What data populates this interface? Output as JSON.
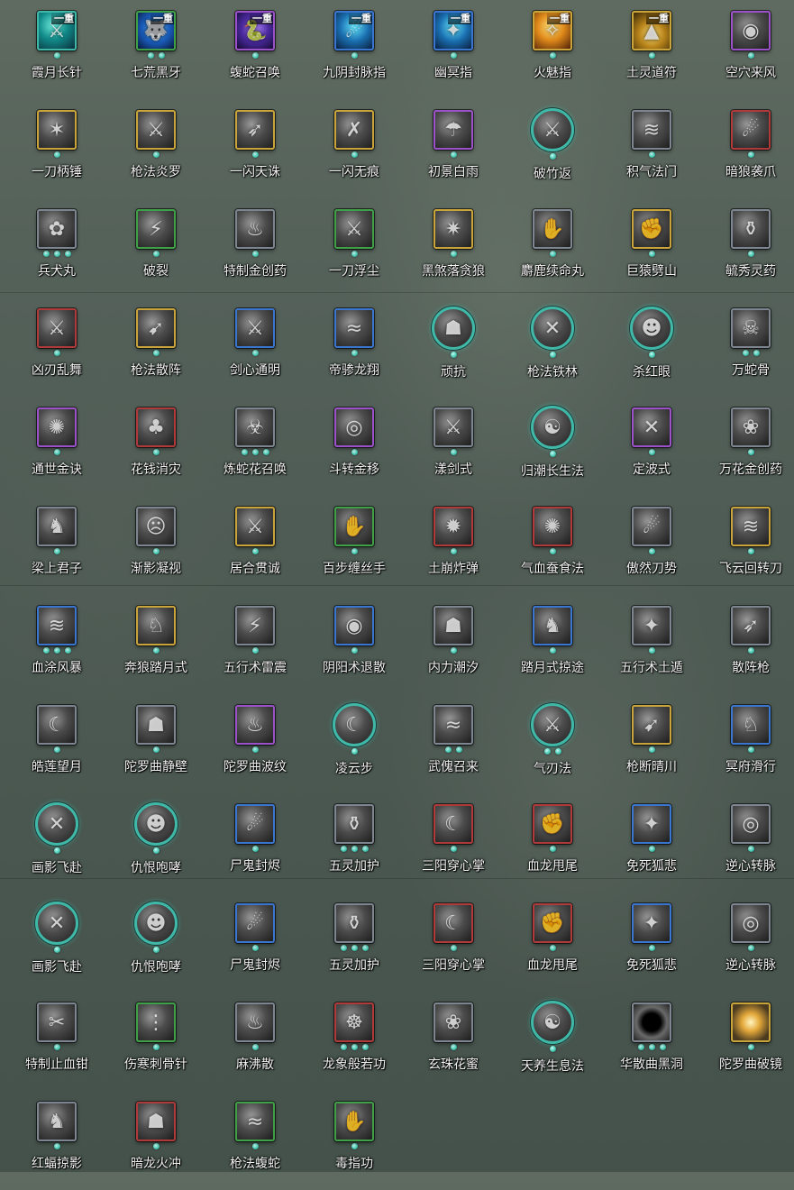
{
  "skills": [
    {
      "name": "霞月长针",
      "badge": "一重",
      "dots": 1,
      "border": "teal",
      "style": "c-cyan",
      "glyph": "⚔"
    },
    {
      "name": "七荒黑牙",
      "badge": "一重",
      "dots": 2,
      "border": "green",
      "style": "c-blue",
      "glyph": "🐺"
    },
    {
      "name": "蝮蛇召唤",
      "badge": "一重",
      "dots": 1,
      "border": "purple",
      "style": "c-violet",
      "glyph": "🐍"
    },
    {
      "name": "九阴封脉指",
      "badge": "一重",
      "dots": 1,
      "border": "blue",
      "style": "c-cyan2",
      "glyph": "☄"
    },
    {
      "name": "幽冥指",
      "badge": "一重",
      "dots": 1,
      "border": "blue",
      "style": "c-cyan2",
      "glyph": "✦"
    },
    {
      "name": "火魅指",
      "badge": "一重",
      "dots": 1,
      "border": "gold",
      "style": "c-fire",
      "glyph": "✧"
    },
    {
      "name": "土灵道符",
      "badge": "一重",
      "dots": 1,
      "border": "gold",
      "style": "c-gold",
      "glyph": "▲"
    },
    {
      "name": "空穴来风",
      "badge": "",
      "dots": 1,
      "border": "purple",
      "style": "",
      "glyph": "◉"
    },
    {
      "name": "一刀柄锤",
      "badge": "",
      "dots": 1,
      "border": "gold",
      "style": "",
      "glyph": "✶"
    },
    {
      "name": "枪法炎罗",
      "badge": "",
      "dots": 1,
      "border": "gold",
      "style": "",
      "glyph": "⚔"
    },
    {
      "name": "一闪天诛",
      "badge": "",
      "dots": 1,
      "border": "gold",
      "style": "",
      "glyph": "➶"
    },
    {
      "name": "一闪无痕",
      "badge": "",
      "dots": 1,
      "border": "gold",
      "style": "",
      "glyph": "✗"
    },
    {
      "name": "初景白雨",
      "badge": "",
      "dots": 1,
      "border": "purple",
      "style": "",
      "glyph": "☂"
    },
    {
      "name": "破竹返",
      "badge": "",
      "dots": 1,
      "border": "round",
      "style": "",
      "glyph": "⚔"
    },
    {
      "name": "积气法门",
      "badge": "",
      "dots": 1,
      "border": "gray",
      "style": "",
      "glyph": "≋"
    },
    {
      "name": "暗狼袭爪",
      "badge": "",
      "dots": 1,
      "border": "red",
      "style": "",
      "glyph": "☄"
    },
    {
      "name": "兵犬丸",
      "badge": "",
      "dots": 3,
      "border": "gray",
      "style": "",
      "glyph": "✿"
    },
    {
      "name": "破裂",
      "badge": "",
      "dots": 1,
      "border": "green",
      "style": "",
      "glyph": "⚡"
    },
    {
      "name": "特制金创药",
      "badge": "",
      "dots": 1,
      "border": "gray",
      "style": "",
      "glyph": "♨"
    },
    {
      "name": "一刀浮尘",
      "badge": "",
      "dots": 1,
      "border": "green",
      "style": "",
      "glyph": "⚔"
    },
    {
      "name": "黑煞落贪狼",
      "badge": "",
      "dots": 1,
      "border": "gold",
      "style": "",
      "glyph": "✷"
    },
    {
      "name": "麝鹿续命丸",
      "badge": "",
      "dots": 1,
      "border": "gray",
      "style": "",
      "glyph": "✋"
    },
    {
      "name": "巨猿劈山",
      "badge": "",
      "dots": 1,
      "border": "gold",
      "style": "",
      "glyph": "✊"
    },
    {
      "name": "毓秀灵药",
      "badge": "",
      "dots": 1,
      "border": "gray",
      "style": "",
      "glyph": "⚱"
    },
    {
      "name": "凶刃乱舞",
      "badge": "",
      "dots": 1,
      "border": "red",
      "style": "",
      "glyph": "⚔"
    },
    {
      "name": "枪法散阵",
      "badge": "",
      "dots": 1,
      "border": "gold",
      "style": "",
      "glyph": "➹"
    },
    {
      "name": "剑心通明",
      "badge": "",
      "dots": 1,
      "border": "blue",
      "style": "",
      "glyph": "⚔"
    },
    {
      "name": "帝骖龙翔",
      "badge": "",
      "dots": 1,
      "border": "blue",
      "style": "",
      "glyph": "≈"
    },
    {
      "name": "顽抗",
      "badge": "",
      "dots": 1,
      "border": "round",
      "style": "",
      "glyph": "☗"
    },
    {
      "name": "枪法铁林",
      "badge": "",
      "dots": 1,
      "border": "round",
      "style": "",
      "glyph": "✕"
    },
    {
      "name": "杀红眼",
      "badge": "",
      "dots": 1,
      "border": "round",
      "style": "",
      "glyph": "☻"
    },
    {
      "name": "万蛇骨",
      "badge": "",
      "dots": 2,
      "border": "gray",
      "style": "",
      "glyph": "☠"
    },
    {
      "name": "通世金诀",
      "badge": "",
      "dots": 1,
      "border": "purple",
      "style": "",
      "glyph": "✺"
    },
    {
      "name": "花钱消灾",
      "badge": "",
      "dots": 1,
      "border": "red",
      "style": "",
      "glyph": "♣"
    },
    {
      "name": "炼蛇花召唤",
      "badge": "",
      "dots": 3,
      "border": "gray",
      "style": "",
      "glyph": "☣"
    },
    {
      "name": "斗转金移",
      "badge": "",
      "dots": 1,
      "border": "purple",
      "style": "",
      "glyph": "◎"
    },
    {
      "name": "漾剑式",
      "badge": "",
      "dots": 1,
      "border": "gray",
      "style": "",
      "glyph": "⚔"
    },
    {
      "name": "归潮长生法",
      "badge": "",
      "dots": 1,
      "border": "round",
      "style": "",
      "glyph": "☯"
    },
    {
      "name": "定波式",
      "badge": "",
      "dots": 1,
      "border": "purple",
      "style": "",
      "glyph": "✕"
    },
    {
      "name": "万花金创药",
      "badge": "",
      "dots": 1,
      "border": "gray",
      "style": "",
      "glyph": "❀"
    },
    {
      "name": "梁上君子",
      "badge": "",
      "dots": 1,
      "border": "gray",
      "style": "",
      "glyph": "♞"
    },
    {
      "name": "渐影凝视",
      "badge": "",
      "dots": 1,
      "border": "gray",
      "style": "",
      "glyph": "☹"
    },
    {
      "name": "居合贯诚",
      "badge": "",
      "dots": 1,
      "border": "gold",
      "style": "",
      "glyph": "⚔"
    },
    {
      "name": "百步缠丝手",
      "badge": "",
      "dots": 1,
      "border": "green",
      "style": "",
      "glyph": "✋"
    },
    {
      "name": "土崩炸弹",
      "badge": "",
      "dots": 1,
      "border": "red",
      "style": "",
      "glyph": "✹"
    },
    {
      "name": "气血蚕食法",
      "badge": "",
      "dots": 1,
      "border": "red",
      "style": "",
      "glyph": "✺"
    },
    {
      "name": "傲然刀势",
      "badge": "",
      "dots": 1,
      "border": "gray",
      "style": "",
      "glyph": "☄"
    },
    {
      "name": "飞云回转刀",
      "badge": "",
      "dots": 1,
      "border": "gold",
      "style": "",
      "glyph": "≋"
    },
    {
      "name": "血涂风暴",
      "badge": "",
      "dots": 3,
      "border": "blue",
      "style": "",
      "glyph": "≋"
    },
    {
      "name": "奔狼踏月式",
      "badge": "",
      "dots": 1,
      "border": "gold",
      "style": "",
      "glyph": "♘"
    },
    {
      "name": "五行术雷震",
      "badge": "",
      "dots": 1,
      "border": "gray",
      "style": "",
      "glyph": "⚡"
    },
    {
      "name": "阴阳术退散",
      "badge": "",
      "dots": 1,
      "border": "blue",
      "style": "",
      "glyph": "◉"
    },
    {
      "name": "内力潮汐",
      "badge": "",
      "dots": 1,
      "border": "gray",
      "style": "",
      "glyph": "☗"
    },
    {
      "name": "踏月式掠途",
      "badge": "",
      "dots": 1,
      "border": "blue",
      "style": "",
      "glyph": "♞"
    },
    {
      "name": "五行术土遁",
      "badge": "",
      "dots": 1,
      "border": "gray",
      "style": "",
      "glyph": "✦"
    },
    {
      "name": "散阵枪",
      "badge": "",
      "dots": 1,
      "border": "gray",
      "style": "",
      "glyph": "➶"
    },
    {
      "name": "皓莲望月",
      "badge": "",
      "dots": 1,
      "border": "gray",
      "style": "",
      "glyph": "☾"
    },
    {
      "name": "陀罗曲静壁",
      "badge": "",
      "dots": 1,
      "border": "gray",
      "style": "",
      "glyph": "☗"
    },
    {
      "name": "陀罗曲波纹",
      "badge": "",
      "dots": 1,
      "border": "purple",
      "style": "",
      "glyph": "♨"
    },
    {
      "name": "凌云步",
      "badge": "",
      "dots": 1,
      "border": "round",
      "style": "",
      "glyph": "☾"
    },
    {
      "name": "武傀召来",
      "badge": "",
      "dots": 2,
      "border": "gray",
      "style": "",
      "glyph": "≈"
    },
    {
      "name": "气刃法",
      "badge": "",
      "dots": 2,
      "border": "round",
      "style": "",
      "glyph": "⚔"
    },
    {
      "name": "枪断晴川",
      "badge": "",
      "dots": 1,
      "border": "gold",
      "style": "",
      "glyph": "➹"
    },
    {
      "name": "冥府滑行",
      "badge": "",
      "dots": 1,
      "border": "blue",
      "style": "",
      "glyph": "♘"
    },
    {
      "name": "画影飞赴",
      "badge": "",
      "dots": 1,
      "border": "round",
      "style": "",
      "glyph": "✕"
    },
    {
      "name": "仇恨咆哮",
      "badge": "",
      "dots": 1,
      "border": "round",
      "style": "",
      "glyph": "☻"
    },
    {
      "name": "尸鬼封烬",
      "badge": "",
      "dots": 1,
      "border": "blue",
      "style": "",
      "glyph": "☄"
    },
    {
      "name": "五灵加护",
      "badge": "",
      "dots": 3,
      "border": "gray",
      "style": "",
      "glyph": "⚱"
    },
    {
      "name": "三阳穿心掌",
      "badge": "",
      "dots": 1,
      "border": "red",
      "style": "",
      "glyph": "☾"
    },
    {
      "name": "血龙甩尾",
      "badge": "",
      "dots": 1,
      "border": "red",
      "style": "",
      "glyph": "✊"
    },
    {
      "name": "免死狐悲",
      "badge": "",
      "dots": 1,
      "border": "blue",
      "style": "",
      "glyph": "✦"
    },
    {
      "name": "逆心转脉",
      "badge": "",
      "dots": 1,
      "border": "gray",
      "style": "",
      "glyph": "◎"
    },
    {
      "name": "画影飞赴",
      "badge": "",
      "dots": 1,
      "border": "round",
      "style": "",
      "glyph": "✕"
    },
    {
      "name": "仇恨咆哮",
      "badge": "",
      "dots": 1,
      "border": "round",
      "style": "",
      "glyph": "☻"
    },
    {
      "name": "尸鬼封烬",
      "badge": "",
      "dots": 1,
      "border": "blue",
      "style": "",
      "glyph": "☄"
    },
    {
      "name": "五灵加护",
      "badge": "",
      "dots": 3,
      "border": "gray",
      "style": "",
      "glyph": "⚱"
    },
    {
      "name": "三阳穿心掌",
      "badge": "",
      "dots": 1,
      "border": "red",
      "style": "",
      "glyph": "☾"
    },
    {
      "name": "血龙甩尾",
      "badge": "",
      "dots": 1,
      "border": "red",
      "style": "",
      "glyph": "✊"
    },
    {
      "name": "免死狐悲",
      "badge": "",
      "dots": 1,
      "border": "blue",
      "style": "",
      "glyph": "✦"
    },
    {
      "name": "逆心转脉",
      "badge": "",
      "dots": 1,
      "border": "gray",
      "style": "",
      "glyph": "◎"
    },
    {
      "name": "特制止血钳",
      "badge": "",
      "dots": 1,
      "border": "gray",
      "style": "",
      "glyph": "✂"
    },
    {
      "name": "伤寒刺骨针",
      "badge": "",
      "dots": 1,
      "border": "green",
      "style": "",
      "glyph": "⋮"
    },
    {
      "name": "麻沸散",
      "badge": "",
      "dots": 1,
      "border": "gray",
      "style": "",
      "glyph": "♨"
    },
    {
      "name": "龙象般若功",
      "badge": "",
      "dots": 3,
      "border": "red",
      "style": "",
      "glyph": "☸"
    },
    {
      "name": "玄珠花蜜",
      "badge": "",
      "dots": 1,
      "border": "gray",
      "style": "",
      "glyph": "❀"
    },
    {
      "name": "天养生息法",
      "badge": "",
      "dots": 1,
      "border": "round",
      "style": "",
      "glyph": "☯"
    },
    {
      "name": "华散曲黑洞",
      "badge": "",
      "dots": 3,
      "border": "gray",
      "style": "c-black",
      "glyph": ""
    },
    {
      "name": "陀罗曲破镜",
      "badge": "",
      "dots": 1,
      "border": "gold",
      "style": "c-golden-orb",
      "glyph": ""
    },
    {
      "name": "红蝠掠影",
      "badge": "",
      "dots": 1,
      "border": "gray",
      "style": "",
      "glyph": "♞"
    },
    {
      "name": "暗龙火冲",
      "badge": "",
      "dots": 1,
      "border": "red",
      "style": "",
      "glyph": "☗"
    },
    {
      "name": "枪法蝮蛇",
      "badge": "",
      "dots": 1,
      "border": "green",
      "style": "",
      "glyph": "≈"
    },
    {
      "name": "毒指功",
      "badge": "",
      "dots": 1,
      "border": "green",
      "style": "",
      "glyph": "✋"
    }
  ]
}
